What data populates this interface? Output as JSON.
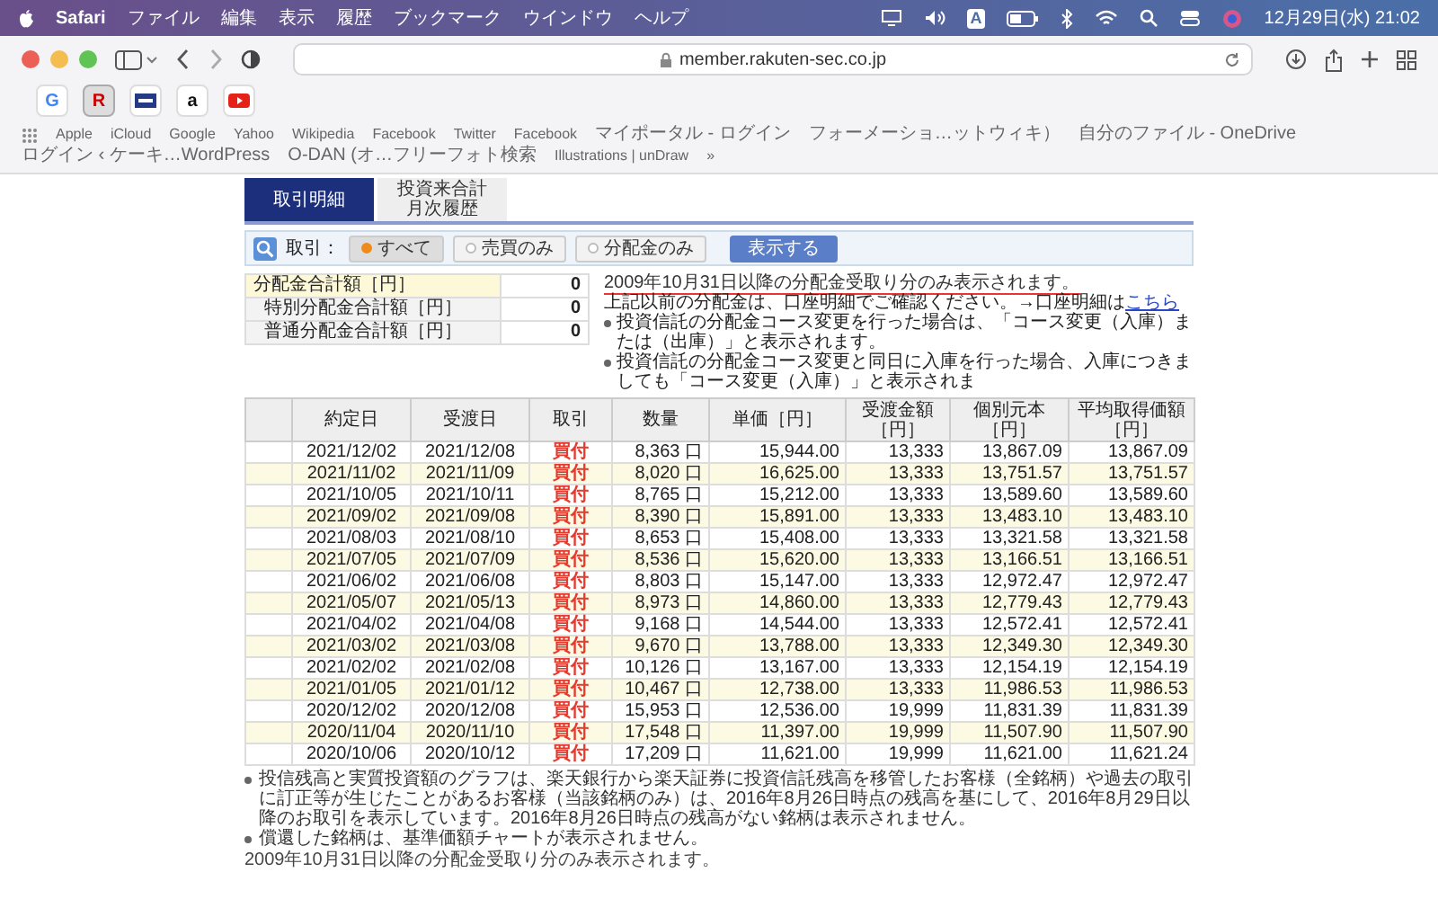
{
  "menubar": {
    "app": "Safari",
    "menus": [
      "ファイル",
      "編集",
      "表示",
      "履歴",
      "ブックマーク",
      "ウインドウ",
      "ヘルプ"
    ],
    "input_mode": "A",
    "clock": "12月29日(水) 21:02"
  },
  "toolbar": {
    "address": "member.rakuten-sec.co.jp"
  },
  "favorites": [
    {
      "kind": "letter",
      "label": "G",
      "selected": false
    },
    {
      "kind": "letter",
      "label": "R",
      "selected": true
    },
    {
      "kind": "bank",
      "selected": false
    },
    {
      "kind": "letter",
      "label": "a",
      "selected": false
    },
    {
      "kind": "video",
      "selected": false
    }
  ],
  "bookmarks": [
    "Apple",
    "iCloud",
    "Google",
    "Yahoo",
    "Wikipedia",
    "Facebook",
    "Twitter",
    "Facebook",
    "マイポータル - ログイン",
    "フォーメーショ…ットウィキ）",
    "自分のファイル - OneDrive",
    "ログイン ‹ ケーキ…WordPress",
    "O-DAN (オ…フリーフォト検索",
    "Illustrations | unDraw",
    "»"
  ],
  "tabs": [
    {
      "lines": [
        "取引明細"
      ],
      "selected": true
    },
    {
      "lines": [
        "投資来合計",
        "月次履歴"
      ],
      "selected": false
    }
  ],
  "filter": {
    "label": "取引：",
    "options": [
      {
        "label": "すべて",
        "selected": true
      },
      {
        "label": "売買のみ",
        "selected": false
      },
      {
        "label": "分配金のみ",
        "selected": false
      }
    ],
    "button": "表示する"
  },
  "summary": [
    {
      "label": "分配金合計額［円］",
      "value": "0",
      "kind": "total"
    },
    {
      "label": "特別分配金合計額［円］",
      "value": "0",
      "kind": "sub"
    },
    {
      "label": "普通分配金合計額［円］",
      "value": "0",
      "kind": "sub"
    }
  ],
  "notes": {
    "headline": "2009年10月31日以降の分配金受取り分のみ表示されます。",
    "text": "上記以前の分配金は、口座明細でご確認ください。→口座明細は",
    "link": "こちら",
    "bullets": [
      "投資信託の分配金コース変更を行った場合は、「コース変更（入庫）または（出庫）」と表示されます。",
      "投資信託の分配金コース変更と同日に入庫を行った場合、入庫につきましても「コース変更（入庫）」と表示されま"
    ]
  },
  "table": {
    "columns": [
      "約定日",
      "受渡日",
      "取引",
      "数量",
      "単価［円］",
      "受渡金額［円］",
      "個別元本［円］",
      "平均取得価額［円］"
    ],
    "rows": [
      [
        "2021/12/02",
        "2021/12/08",
        "買付",
        "8,363 口",
        "15,944.00",
        "13,333",
        "13,867.09",
        "13,867.09"
      ],
      [
        "2021/11/02",
        "2021/11/09",
        "買付",
        "8,020 口",
        "16,625.00",
        "13,333",
        "13,751.57",
        "13,751.57"
      ],
      [
        "2021/10/05",
        "2021/10/11",
        "買付",
        "8,765 口",
        "15,212.00",
        "13,333",
        "13,589.60",
        "13,589.60"
      ],
      [
        "2021/09/02",
        "2021/09/08",
        "買付",
        "8,390 口",
        "15,891.00",
        "13,333",
        "13,483.10",
        "13,483.10"
      ],
      [
        "2021/08/03",
        "2021/08/10",
        "買付",
        "8,653 口",
        "15,408.00",
        "13,333",
        "13,321.58",
        "13,321.58"
      ],
      [
        "2021/07/05",
        "2021/07/09",
        "買付",
        "8,536 口",
        "15,620.00",
        "13,333",
        "13,166.51",
        "13,166.51"
      ],
      [
        "2021/06/02",
        "2021/06/08",
        "買付",
        "8,803 口",
        "15,147.00",
        "13,333",
        "12,972.47",
        "12,972.47"
      ],
      [
        "2021/05/07",
        "2021/05/13",
        "買付",
        "8,973 口",
        "14,860.00",
        "13,333",
        "12,779.43",
        "12,779.43"
      ],
      [
        "2021/04/02",
        "2021/04/08",
        "買付",
        "9,168 口",
        "14,544.00",
        "13,333",
        "12,572.41",
        "12,572.41"
      ],
      [
        "2021/03/02",
        "2021/03/08",
        "買付",
        "9,670 口",
        "13,788.00",
        "13,333",
        "12,349.30",
        "12,349.30"
      ],
      [
        "2021/02/02",
        "2021/02/08",
        "買付",
        "10,126 口",
        "13,167.00",
        "13,333",
        "12,154.19",
        "12,154.19"
      ],
      [
        "2021/01/05",
        "2021/01/12",
        "買付",
        "10,467 口",
        "12,738.00",
        "13,333",
        "11,986.53",
        "11,986.53"
      ],
      [
        "2020/12/02",
        "2020/12/08",
        "買付",
        "15,953 口",
        "12,536.00",
        "19,999",
        "11,831.39",
        "11,831.39"
      ],
      [
        "2020/11/04",
        "2020/11/10",
        "買付",
        "17,548 口",
        "11,397.00",
        "19,999",
        "11,507.90",
        "11,507.90"
      ],
      [
        "2020/10/06",
        "2020/10/12",
        "買付",
        "17,209 口",
        "11,621.00",
        "19,999",
        "11,621.00",
        "11,621.24"
      ]
    ]
  },
  "footnotes": [
    "投信残高と実質投資額のグラフは、楽天銀行から楽天証券に投資信託残高を移管したお客様（全銘柄）や過去の取引に訂正等が生じたことがあるお客様（当該銘柄のみ）は、2016年8月26日時点の残高を基にして、2016年8月29日以降のお取引を表示しています。2016年8月26日時点の残高がない銘柄は表示されません。",
    "償還した銘柄は、基準価額チャートが表示されません。"
  ],
  "bottom_note": "2009年10月31日以降の分配金受取り分のみ表示されます。"
}
